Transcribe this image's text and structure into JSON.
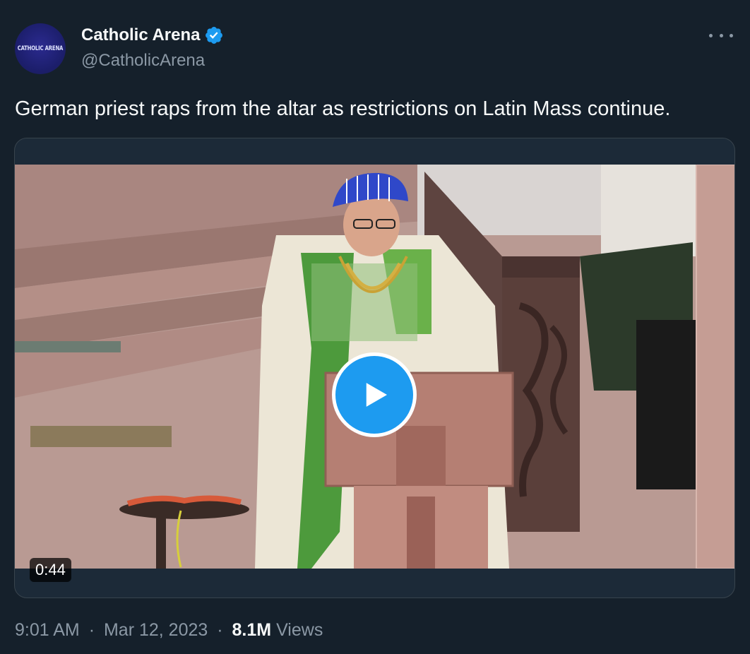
{
  "author": {
    "avatar_text": "CATHOLIC ARENA",
    "display_name": "Catholic Arena",
    "handle": "@CatholicArena",
    "verified_icon": "verified-badge-icon",
    "verified_color": "#1d9bf0"
  },
  "tweet": {
    "text": "German priest raps from the altar as restrictions on Latin Mass continue."
  },
  "media": {
    "type": "video",
    "duration": "0:44",
    "play_icon": "play-icon",
    "play_color": "#1d9bf0"
  },
  "meta": {
    "time": "9:01 AM",
    "separator": "·",
    "date": "Mar 12, 2023",
    "views_count": "8.1M",
    "views_label": "Views"
  },
  "colors": {
    "background": "#15202b",
    "text_primary": "#f7f9f9",
    "text_secondary": "#8b98a5",
    "border": "#38444d"
  }
}
